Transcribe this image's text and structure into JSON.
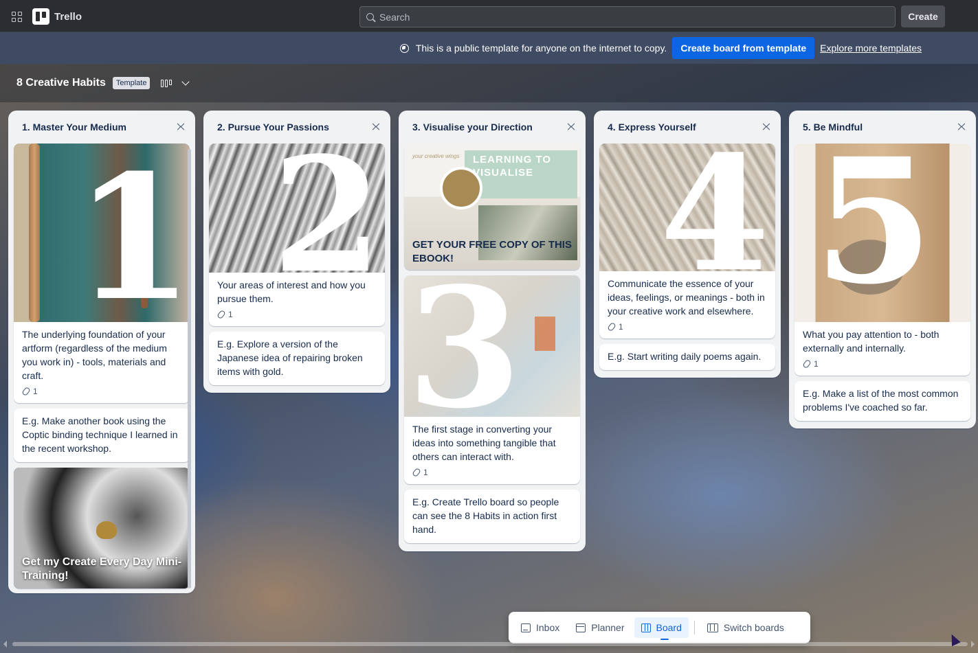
{
  "topbar": {
    "app_name": "Trello",
    "search_placeholder": "Search",
    "create_label": "Create"
  },
  "banner": {
    "message": "This is a public template for anyone on the internet to copy.",
    "primary_button": "Create board from template",
    "link": "Explore more templates"
  },
  "board": {
    "title": "8 Creative Habits",
    "badge": "Template"
  },
  "lists": [
    {
      "title": "1. Master Your Medium",
      "cover_number": "1",
      "card1_text": "The underlying foundation of your artform (regardless of the medium you work in) - tools, materials and craft.",
      "card1_attachments": "1",
      "card2_text": "E.g. Make another book using the Coptic binding technique I learned in the recent workshop.",
      "card3_title": "Get my Create Every Day Mini-Training!"
    },
    {
      "title": "2. Pursue Your Passions",
      "cover_number": "2",
      "card1_text": "Your areas of interest and how you pursue them.",
      "card1_attachments": "1",
      "card2_text": "E.g. Explore a version of the Japanese idea of repairing broken items with gold."
    },
    {
      "title": "3. Visualise your Direction",
      "ebook_brand": "your creative wings",
      "ebook_heading": "LEARNING TO VISUALISE",
      "ebook_title": "GET YOUR FREE COPY OF THIS EBOOK!",
      "cover_number": "3",
      "card2_text": "The first stage in converting your ideas into something tangible that others can interact with.",
      "card2_attachments": "1",
      "card3_text": "E.g. Create Trello board so people can see the 8 Habits in action first hand."
    },
    {
      "title": "4. Express Yourself",
      "cover_number": "4",
      "card1_text": "Communicate the essence of your ideas, feelings, or meanings - both in your creative work and elsewhere.",
      "card1_attachments": "1",
      "card2_text": "E.g. Start writing daily poems again."
    },
    {
      "title": "5. Be Mindful",
      "cover_number": "5",
      "card1_text": "What you pay attention to - both externally and internally.",
      "card1_attachments": "1",
      "card2_text": "E.g. Make a list of the most common problems I've coached so far."
    }
  ],
  "bottom_nav": {
    "inbox": "Inbox",
    "planner": "Planner",
    "board": "Board",
    "switch": "Switch boards"
  },
  "colors": {
    "accent": "#0c66e4",
    "topbar": "#2b2d31",
    "banner": "#3f4a63",
    "list_bg": "#f1f2f4"
  }
}
